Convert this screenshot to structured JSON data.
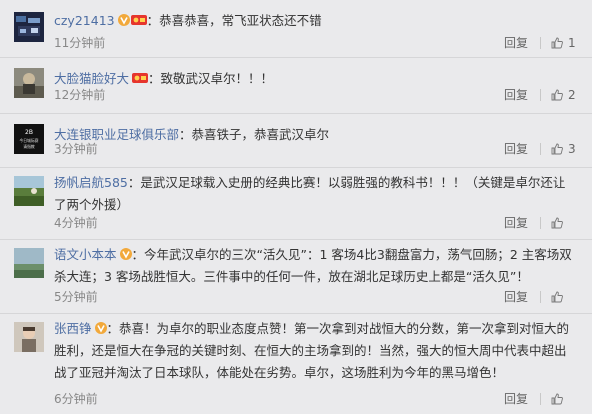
{
  "comments": [
    {
      "username": "czy21413",
      "badges": [
        "v",
        "member"
      ],
      "text": "恭喜恭喜，常飞亚状态还不错",
      "time": "11分钟前",
      "reply_label": "回复",
      "likes": "1"
    },
    {
      "username": "大脸猫脸好大",
      "badges": [
        "member"
      ],
      "text": "致敬武汉卓尔！！！",
      "time": "12分钟前",
      "reply_label": "回复",
      "likes": "2"
    },
    {
      "username": "大连银职业足球俱乐部",
      "badges": [],
      "text": "恭喜铁子，恭喜武汉卓尔",
      "time": "3分钟前",
      "reply_label": "回复",
      "likes": "3",
      "avatar_text": [
        "2B",
        "今日城际赛",
        "请指教"
      ]
    },
    {
      "username": "扬帆启航585",
      "badges": [],
      "text": "是武汉足球载入史册的经典比赛！以弱胜强的教科书！！！（关键是卓尔还让了两个外援）",
      "time": "4分钟前",
      "reply_label": "回复",
      "likes": ""
    },
    {
      "username": "语文小本本",
      "badges": [
        "v"
      ],
      "text": "今年武汉卓尔的三次“活久见”：1 客场4比3翻盘富力，荡气回肠；2 主客场双杀大连；3 客场战胜恒大。三件事中的任何一件，放在湖北足球历史上都是“活久见”！",
      "time": "5分钟前",
      "reply_label": "回复",
      "likes": ""
    },
    {
      "username": "张西铮",
      "badges": [
        "v"
      ],
      "text": "恭喜！为卓尔的职业态度点赞！第一次拿到对战恒大的分数，第一次拿到对恒大的胜利，还是恒大在争冠的关键时刻、在恒大的主场拿到的！当然，强大的恒大周中代表中超出战了亚冠并淘汰了日本球队，体能处在劣势。卓尔，这场胜利为今年的黑马增色！",
      "time": "6分钟前",
      "reply_label": "回复",
      "likes": ""
    }
  ],
  "colors": {
    "username": "#4e6ea3",
    "v_badge": "#f2a93b",
    "member_badge": "#e6352d",
    "background": "#eaeaec"
  },
  "icons": [
    "thumbs-up-icon",
    "v-badge-icon",
    "member-badge-icon"
  ]
}
